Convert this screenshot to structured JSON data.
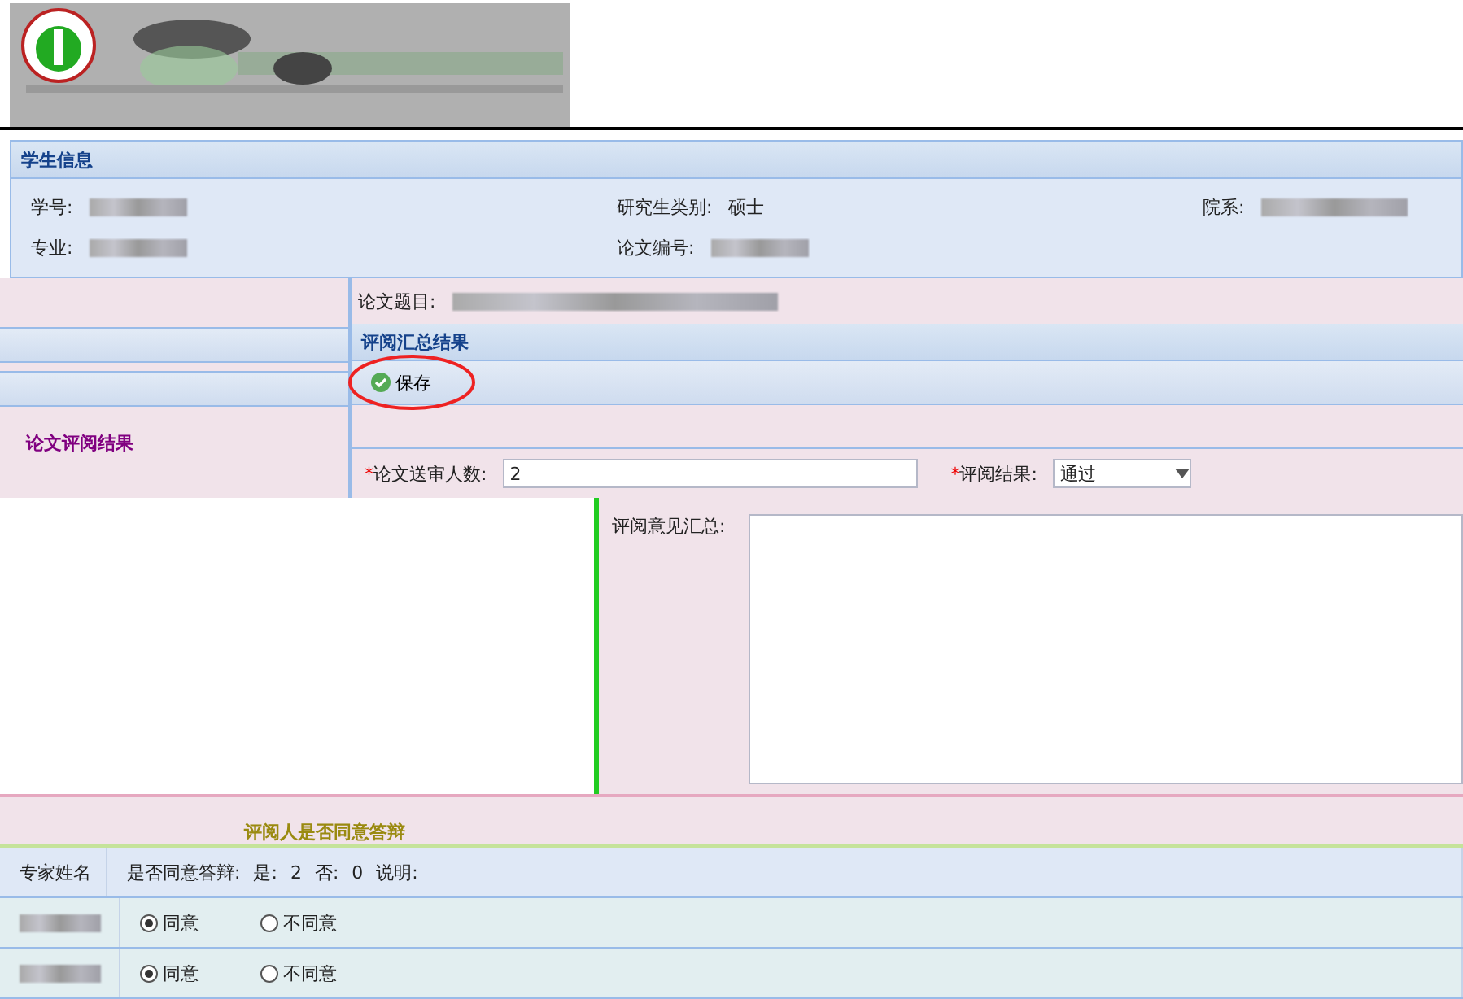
{
  "student_info": {
    "title": "学生信息",
    "fields": [
      {
        "label": "学号:"
      },
      {
        "label": "研究生类别:",
        "value": "硕士"
      },
      {
        "label": "院系:"
      },
      {
        "label": "专业:"
      },
      {
        "label": "论文编号:"
      }
    ]
  },
  "thesis_title": {
    "label": "论文题目:"
  },
  "left_panel": {
    "title": "论文评阅结果"
  },
  "summary_panel": {
    "title": "评阅汇总结果",
    "toolbar": [
      {
        "label": "保存",
        "circled": true
      }
    ],
    "fields": [
      {
        "mark": "*",
        "label": "论文送审人数:",
        "value": "2",
        "kind": "text"
      },
      {
        "mark": "*",
        "label": "评阅结果:",
        "value": "通过",
        "kind": "select"
      }
    ],
    "opinion": {
      "label": "评阅意见汇总:"
    }
  },
  "defense": {
    "title": "评阅人是否同意答辩",
    "name_column": "专家姓名",
    "summary": {
      "label": "是否同意答辩:",
      "yes_label": "是:",
      "yes": "2",
      "no_label": "否:",
      "no": "0",
      "note_label": "说明:"
    },
    "rows": [
      {
        "options": [
          {
            "label": "同意",
            "selected": true
          },
          {
            "label": "不同意",
            "selected": false
          }
        ]
      },
      {
        "options": [
          {
            "label": "同意",
            "selected": true
          },
          {
            "label": "不同意",
            "selected": false
          }
        ]
      }
    ]
  }
}
